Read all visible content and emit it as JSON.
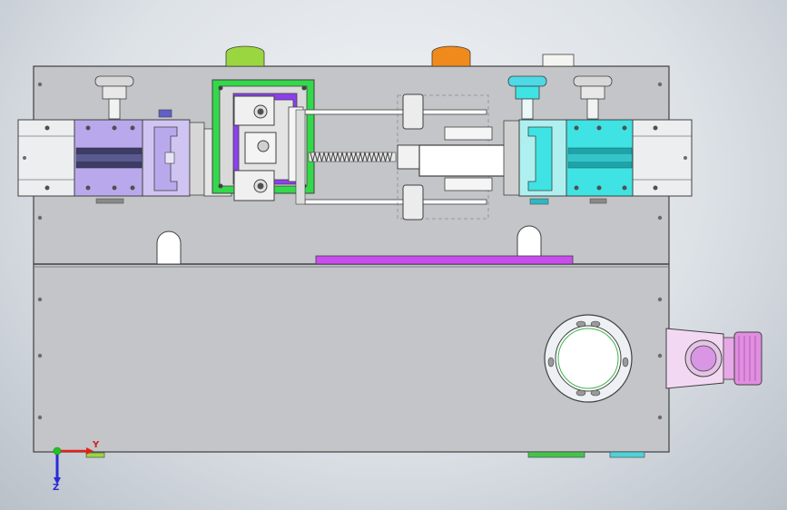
{
  "viewport": {
    "background_top": "#f2f4f6",
    "background_bottom": "#b9c0c8"
  },
  "triad": {
    "y_label": "Y",
    "z_label": "Z",
    "x_axis_color": "#e0201c",
    "y_axis_color": "#2a2ad8",
    "origin_color": "#21c421"
  },
  "colors": {
    "base_plate": "#c3c5c8",
    "edge": "#404040",
    "slide_rail": "#eceef0",
    "purple_part": "#b9a9ec",
    "violet_plate": "#8d3ff0",
    "green_frame": "#33d94a",
    "cyan_part": "#3fe3e3",
    "magenta_strip": "#c84cf0",
    "knob_green": "#9ad640",
    "knob_orange": "#f08a1c",
    "knob_pink": "#e08ee0",
    "knob_cyan": "#4fd8e6"
  },
  "parts": [
    "base-plate",
    "left-slide-assembly",
    "right-slide-assembly",
    "center-clamp-frame",
    "lead-screw",
    "cylinder-actuator",
    "rotary-port",
    "side-knob"
  ]
}
